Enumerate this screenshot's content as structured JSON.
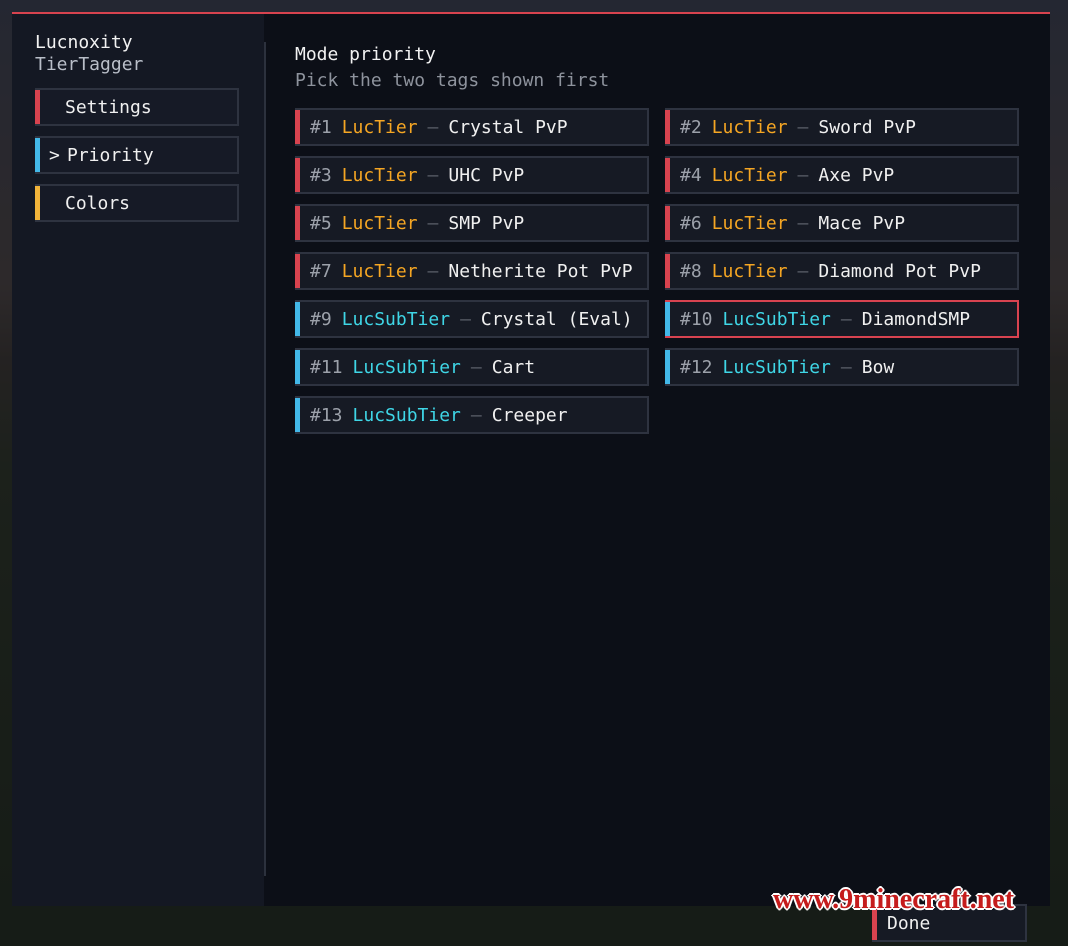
{
  "colors": {
    "accent_red": "#d8434f",
    "accent_blue": "#43b8e8",
    "accent_yellow": "#f2b43a",
    "luctier": "#f5a623",
    "lucsubtier": "#3fd6e6"
  },
  "sidebar": {
    "brand_line1": "Lucnoxity",
    "brand_line2": "TierTagger",
    "items": [
      {
        "label": "Settings",
        "accent": "#d8434f",
        "active": false
      },
      {
        "label": "Priority",
        "accent": "#43b8e8",
        "active": true,
        "chevron": ">"
      },
      {
        "label": "Colors",
        "accent": "#f2b43a",
        "active": false
      }
    ]
  },
  "main": {
    "title": "Mode priority",
    "subtitle": "Pick the two tags shown first",
    "tags": [
      {
        "num": "#1",
        "source": "LucTier",
        "sep": "–",
        "mode": "Crystal PvP"
      },
      {
        "num": "#2",
        "source": "LucTier",
        "sep": "–",
        "mode": "Sword PvP"
      },
      {
        "num": "#3",
        "source": "LucTier",
        "sep": "–",
        "mode": "UHC PvP"
      },
      {
        "num": "#4",
        "source": "LucTier",
        "sep": "–",
        "mode": "Axe PvP"
      },
      {
        "num": "#5",
        "source": "LucTier",
        "sep": "–",
        "mode": "SMP PvP"
      },
      {
        "num": "#6",
        "source": "LucTier",
        "sep": "–",
        "mode": "Mace PvP"
      },
      {
        "num": "#7",
        "source": "LucTier",
        "sep": "–",
        "mode": "Netherite Pot PvP"
      },
      {
        "num": "#8",
        "source": "LucTier",
        "sep": "–",
        "mode": "Diamond Pot PvP"
      },
      {
        "num": "#9",
        "source": "LucSubTier",
        "sep": "–",
        "mode": "Crystal (Eval)"
      },
      {
        "num": "#10",
        "source": "LucSubTier",
        "sep": "–",
        "mode": "DiamondSMP",
        "selected": true
      },
      {
        "num": "#11",
        "source": "LucSubTier",
        "sep": "–",
        "mode": "Cart"
      },
      {
        "num": "#12",
        "source": "LucSubTier",
        "sep": "–",
        "mode": "Bow"
      },
      {
        "num": "#13",
        "source": "LucSubTier",
        "sep": "–",
        "mode": "Creeper"
      }
    ]
  },
  "footer": {
    "done_label": "Done"
  },
  "watermark": "www.9minecraft.net"
}
